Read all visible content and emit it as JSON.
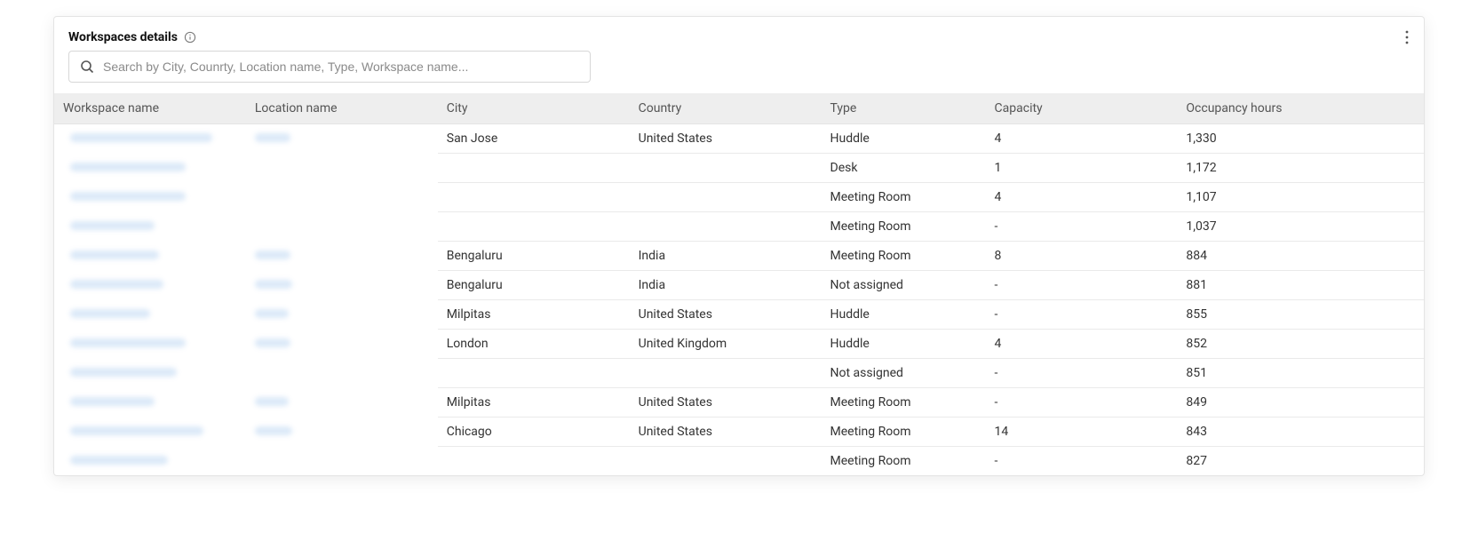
{
  "header": {
    "title": "Workspaces details"
  },
  "search": {
    "placeholder": "Search by City, Counrty, Location name, Type, Workspace name..."
  },
  "table": {
    "columns": {
      "workspace_name": "Workspace name",
      "location_name": "Location name",
      "city": "City",
      "country": "Country",
      "type": "Type",
      "capacity": "Capacity",
      "occupancy_hours": "Occupancy hours"
    },
    "rows": [
      {
        "workspace_name_redacted": true,
        "ws_len": 160,
        "location_name_redacted": true,
        "loc_len": 40,
        "city": "San Jose",
        "country": "United States",
        "type": "Huddle",
        "capacity": "4",
        "occupancy_hours": "1,330"
      },
      {
        "workspace_name_redacted": true,
        "ws_len": 130,
        "location_name_redacted": false,
        "city": "",
        "country": "",
        "type": "Desk",
        "capacity": "1",
        "occupancy_hours": "1,172"
      },
      {
        "workspace_name_redacted": true,
        "ws_len": 130,
        "location_name_redacted": false,
        "city": "",
        "country": "",
        "type": "Meeting Room",
        "capacity": "4",
        "occupancy_hours": "1,107"
      },
      {
        "workspace_name_redacted": true,
        "ws_len": 95,
        "location_name_redacted": false,
        "city": "",
        "country": "",
        "type": "Meeting Room",
        "capacity": "-",
        "occupancy_hours": "1,037"
      },
      {
        "workspace_name_redacted": true,
        "ws_len": 100,
        "location_name_redacted": true,
        "loc_len": 40,
        "city": "Bengaluru",
        "country": "India",
        "type": "Meeting Room",
        "capacity": "8",
        "occupancy_hours": "884"
      },
      {
        "workspace_name_redacted": true,
        "ws_len": 105,
        "location_name_redacted": true,
        "loc_len": 42,
        "city": "Bengaluru",
        "country": "India",
        "type": "Not assigned",
        "capacity": "-",
        "occupancy_hours": "881"
      },
      {
        "workspace_name_redacted": true,
        "ws_len": 90,
        "location_name_redacted": true,
        "loc_len": 38,
        "city": "Milpitas",
        "country": "United States",
        "type": "Huddle",
        "capacity": "-",
        "occupancy_hours": "855"
      },
      {
        "workspace_name_redacted": true,
        "ws_len": 130,
        "location_name_redacted": true,
        "loc_len": 40,
        "city": "London",
        "country": "United Kingdom",
        "type": "Huddle",
        "capacity": "4",
        "occupancy_hours": "852"
      },
      {
        "workspace_name_redacted": true,
        "ws_len": 120,
        "location_name_redacted": false,
        "city": "",
        "country": "",
        "type": "Not assigned",
        "capacity": "-",
        "occupancy_hours": "851"
      },
      {
        "workspace_name_redacted": true,
        "ws_len": 95,
        "location_name_redacted": true,
        "loc_len": 38,
        "city": "Milpitas",
        "country": "United States",
        "type": "Meeting Room",
        "capacity": "-",
        "occupancy_hours": "849"
      },
      {
        "workspace_name_redacted": true,
        "ws_len": 150,
        "location_name_redacted": true,
        "loc_len": 42,
        "city": "Chicago",
        "country": "United States",
        "type": "Meeting Room",
        "capacity": "14",
        "occupancy_hours": "843"
      },
      {
        "workspace_name_redacted": true,
        "ws_len": 110,
        "location_name_redacted": false,
        "city": "",
        "country": "",
        "type": "Meeting Room",
        "capacity": "-",
        "occupancy_hours": "827"
      }
    ]
  }
}
